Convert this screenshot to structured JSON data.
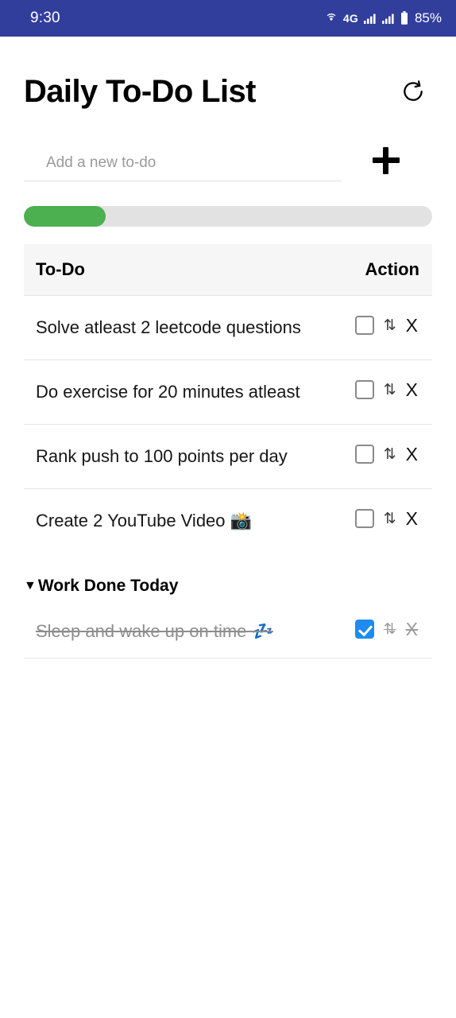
{
  "status_bar": {
    "background": "#323e9c",
    "clock": "9:30",
    "network": "4G",
    "battery": "85%",
    "icons": [
      "hotspot-icon",
      "signal-icon",
      "signal-icon",
      "battery-icon"
    ]
  },
  "header": {
    "title": "Daily To-Do List",
    "reset_icon": "reset-icon"
  },
  "add_todo": {
    "placeholder": "Add a new to-do",
    "value": "",
    "add_icon": "plus-icon"
  },
  "progress": {
    "percent": 20,
    "fill_color": "#4caf50",
    "track_color": "#e2e2e2"
  },
  "table": {
    "columns": [
      "To-Do",
      "Action"
    ],
    "rows": [
      {
        "text": "Solve atleast 2 leetcode questions",
        "checked": false
      },
      {
        "text": "Do exercise for 20 minutes atleast",
        "checked": false
      },
      {
        "text": "Rank push to 100 points per day",
        "checked": false
      },
      {
        "text": "Create 2 YouTube Video 📸",
        "checked": false
      }
    ],
    "move_icon_glyph": "⇅",
    "delete_icon_glyph": "X"
  },
  "done_section": {
    "caret": "▼",
    "title": "Work Done Today",
    "rows": [
      {
        "text": "Sleep and wake up on time 💤",
        "checked": true
      }
    ]
  }
}
